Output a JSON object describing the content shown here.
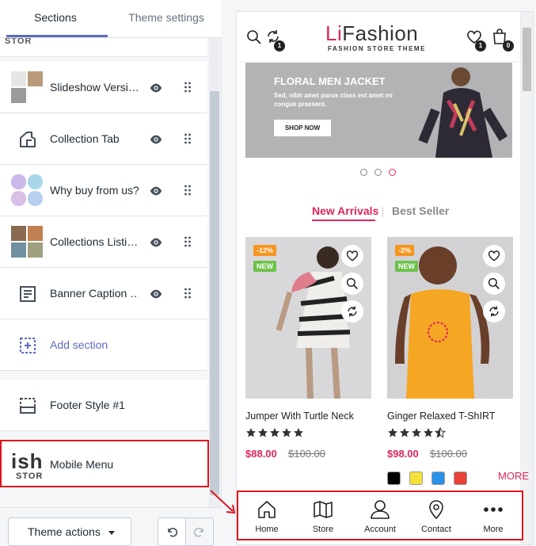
{
  "editor": {
    "tabs": [
      "Sections",
      "Theme settings"
    ],
    "partial_label": "STOR",
    "sections": [
      {
        "label": "Slideshow Versi…",
        "kind": "thumb"
      },
      {
        "label": "Collection Tab",
        "kind": "icon"
      },
      {
        "label": "Why buy from us?",
        "kind": "thumb"
      },
      {
        "label": "Collections Listi…",
        "kind": "thumb"
      },
      {
        "label": "Banner Caption …",
        "kind": "icon"
      }
    ],
    "add_section": "Add section",
    "footer": "Footer Style #1",
    "mobile_menu": "Mobile Menu",
    "mobile_menu_thumb_big": "ish",
    "mobile_menu_thumb_small": "STOR",
    "theme_actions": "Theme actions"
  },
  "store": {
    "logo_prefix": "Li",
    "logo_suffix": "Fashion",
    "tagline": "FASHION STORE THEME",
    "compare_count": "1",
    "wishlist_count": "1",
    "cart_count": "0",
    "slide": {
      "title": "FLORAL MEN JACKET",
      "text": "Sed, nibh amet purus class est amet mi congue praesent.",
      "button": "SHOP NOW"
    },
    "product_tabs": [
      "New Arrivals",
      "Best Seller"
    ],
    "products": [
      {
        "name": "Jumper With Turtle Neck",
        "discount": "-12%",
        "badge": "NEW",
        "rating": 5,
        "price": "$88.00",
        "old_price": "$100.00"
      },
      {
        "name": "Ginger Relaxed T-ShIRT",
        "discount": "-2%",
        "badge": "NEW",
        "rating": 4.5,
        "price": "$98.00",
        "old_price": "$100.00",
        "colors": [
          "#000000",
          "#f5e03a",
          "#2b90e8",
          "#e8413a"
        ],
        "more_label": "MORE"
      }
    ],
    "mobile_menu": [
      "Home",
      "Store",
      "Account",
      "Contact",
      "More"
    ]
  },
  "colors": {
    "accent": "#e0245e",
    "highlight": "#e0141f",
    "editor_accent": "#5c6ac4"
  }
}
